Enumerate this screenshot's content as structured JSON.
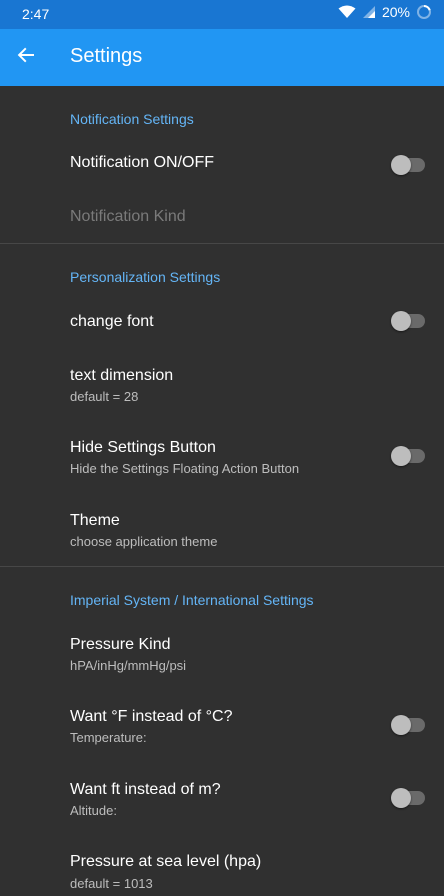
{
  "status_bar": {
    "time": "2:47",
    "battery": "20%",
    "icons": [
      "wifi-icon",
      "signal-icon",
      "battery-icon"
    ]
  },
  "app_bar": {
    "title": "Settings",
    "back_icon": "arrow-left-icon",
    "background": "#2196f3"
  },
  "accent_color": "#64b5f6",
  "sections": {
    "notification": {
      "header": "Notification Settings",
      "items": {
        "notification_onoff": {
          "title": "Notification ON/OFF",
          "toggle": false
        },
        "notification_kind": {
          "title": "Notification Kind"
        }
      }
    },
    "personalization": {
      "header": "Personalization Settings",
      "items": {
        "change_font": {
          "title": "change font",
          "toggle": false
        },
        "text_dimension": {
          "title": "text dimension",
          "summary": "default = 28"
        },
        "hide_settings_button": {
          "title": "Hide Settings Button",
          "summary": "Hide the Settings Floating Action Button",
          "toggle": false
        },
        "theme": {
          "title": "Theme",
          "summary": "choose application theme"
        }
      }
    },
    "imperial": {
      "header": "Imperial System / International Settings",
      "items": {
        "pressure_kind": {
          "title": "Pressure Kind",
          "summary": "hPA/inHg/mmHg/psi"
        },
        "fahrenheit": {
          "title": "Want °F instead of °C?",
          "summary": "Temperature:",
          "toggle": false
        },
        "feet": {
          "title": "Want ft instead of m?",
          "summary": "Altitude:",
          "toggle": false
        },
        "sea_level": {
          "title": "Pressure at sea level (hpa)",
          "summary": "default = 1013"
        }
      }
    }
  }
}
